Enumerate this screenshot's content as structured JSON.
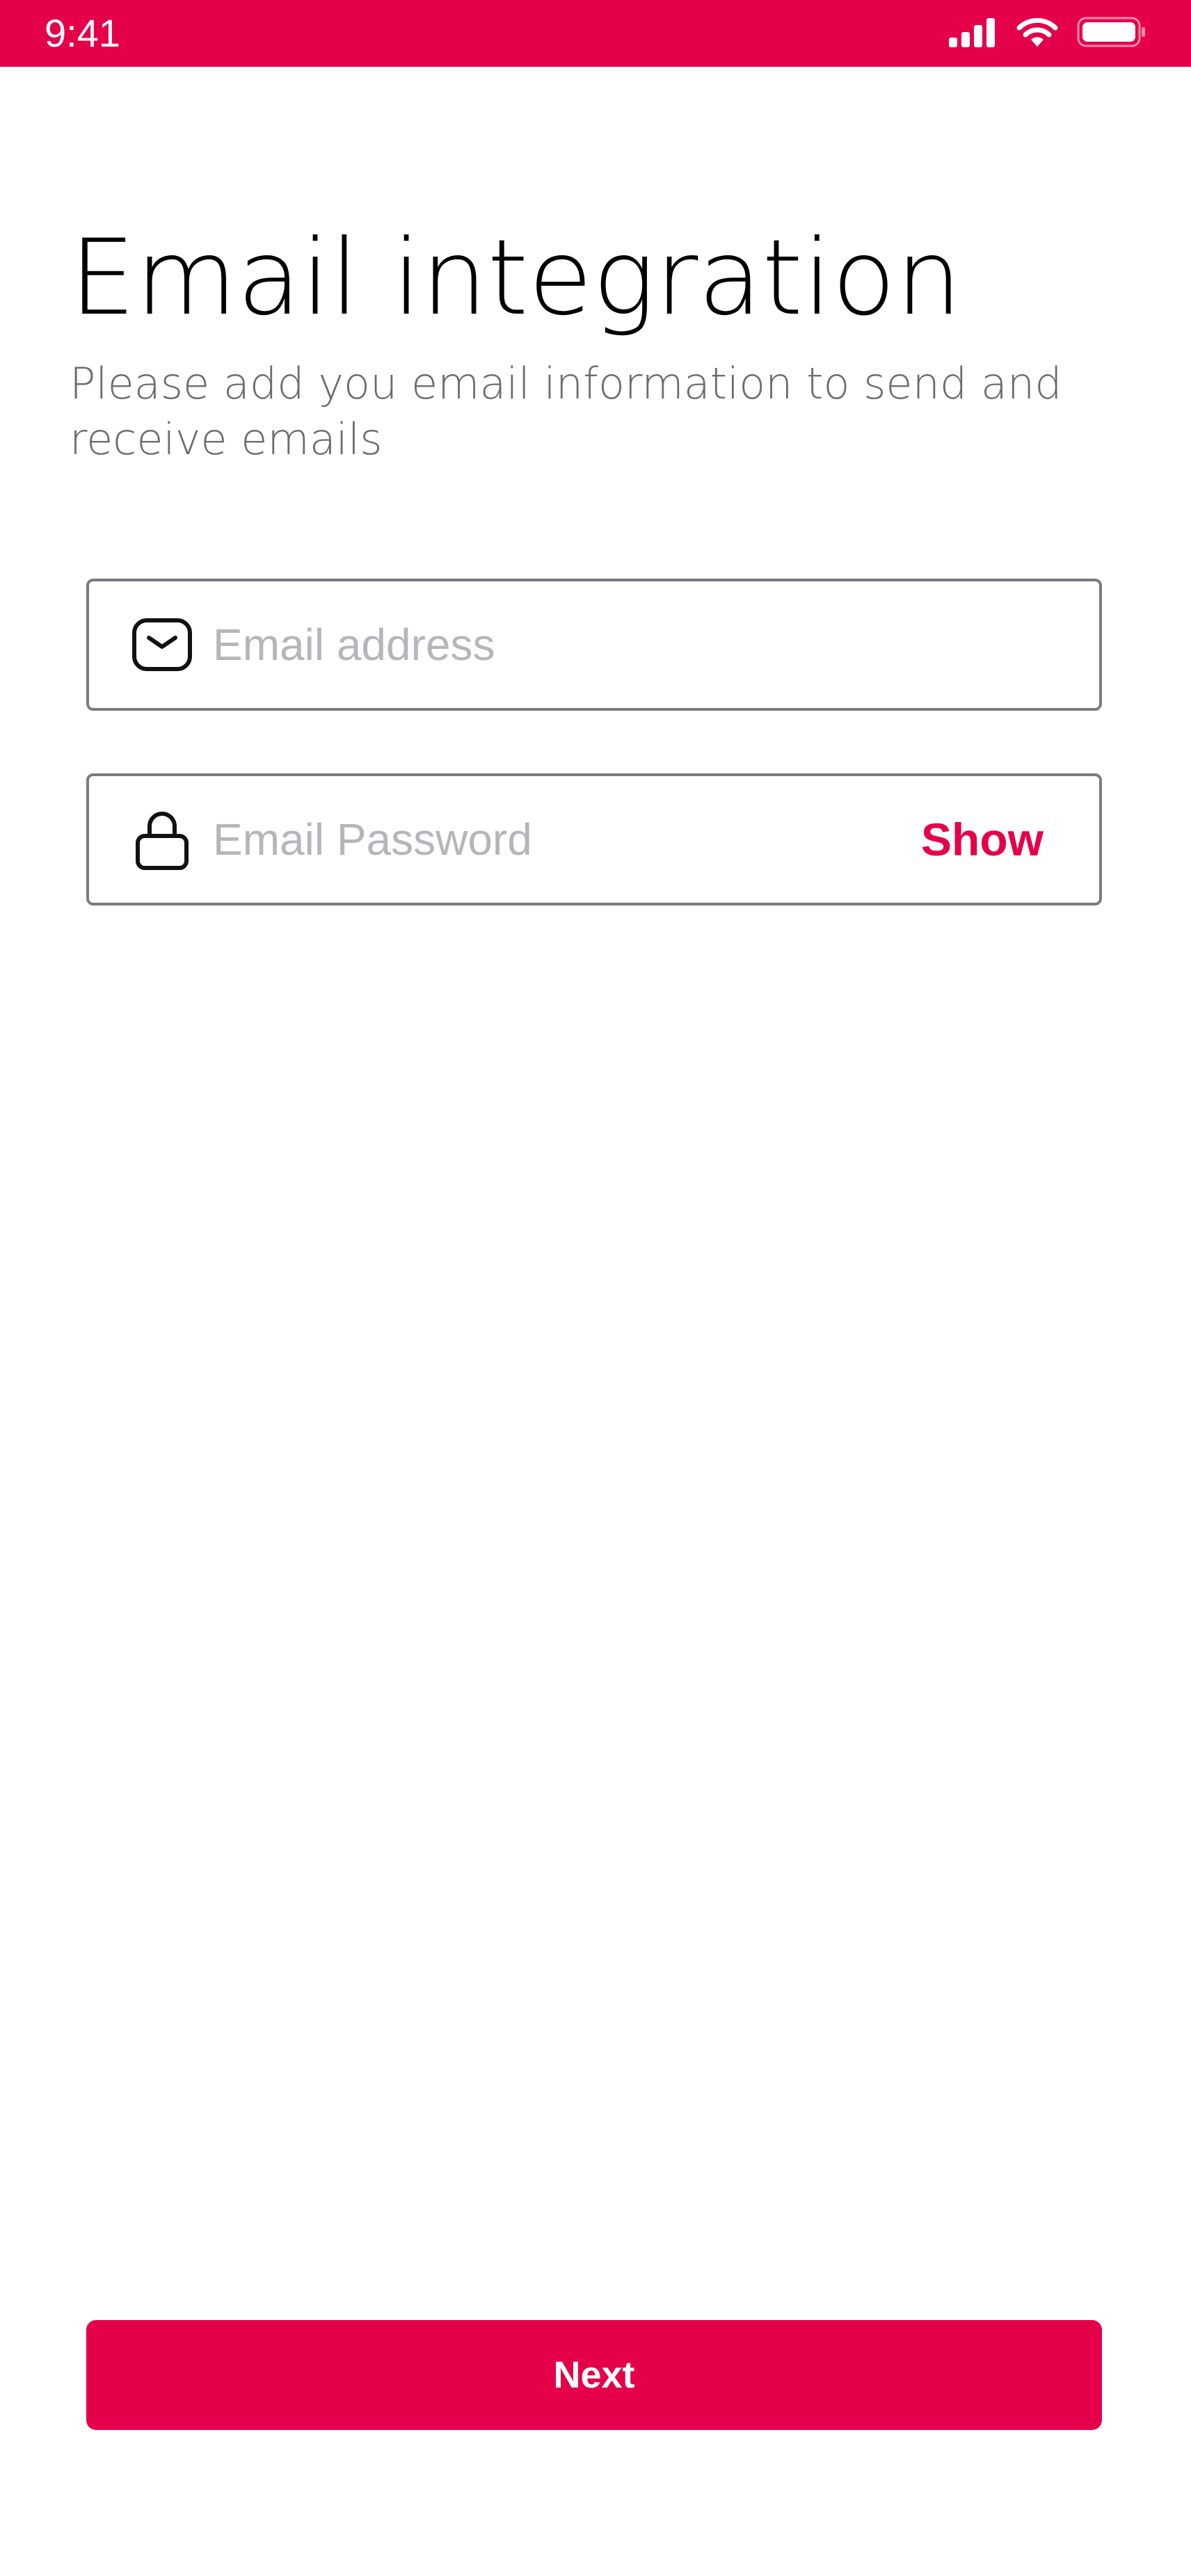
{
  "status_bar": {
    "time": "9:41",
    "icons": [
      "signal-icon",
      "wifi-icon",
      "battery-icon"
    ],
    "background_color": "#E5004A"
  },
  "header": {
    "title": "Email integration",
    "subtitle": "Please add you email information to send and receive emails"
  },
  "form": {
    "email": {
      "placeholder": "Email address",
      "value": "",
      "icon": "mail-icon"
    },
    "password": {
      "placeholder": "Email Password",
      "value": "",
      "icon": "lock-icon",
      "toggle_label": "Show"
    }
  },
  "actions": {
    "next_label": "Next"
  },
  "colors": {
    "accent": "#E5004A",
    "title": "#000000",
    "subtitle": "#6b6b73",
    "placeholder": "#b5b5bc",
    "field_border": "#7a7a82"
  }
}
